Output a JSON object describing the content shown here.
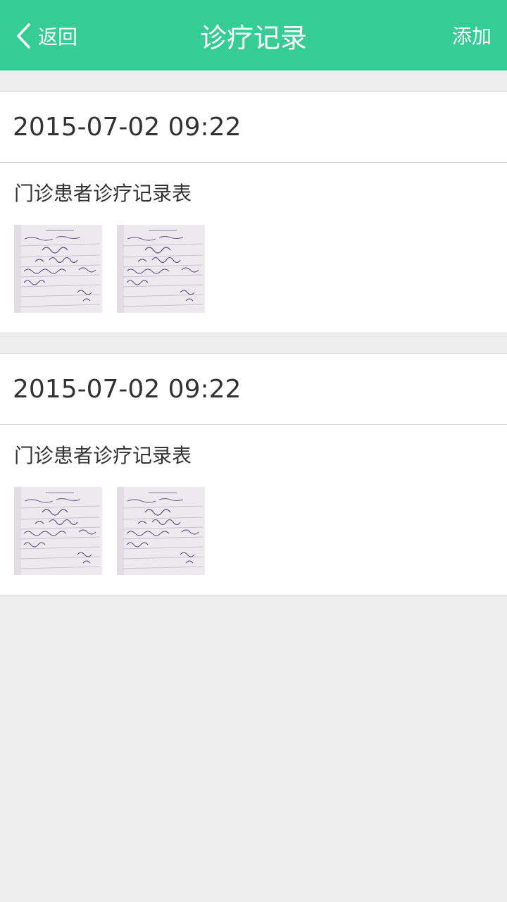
{
  "nav": {
    "back_label": "返回",
    "title": "诊疗记录",
    "add_label": "添加"
  },
  "records": [
    {
      "datetime": "2015-07-02 09:22",
      "name": "门诊患者诊疗记录表",
      "images": [
        "record-photo",
        "record-photo"
      ]
    },
    {
      "datetime": "2015-07-02 09:22",
      "name": "门诊患者诊疗记录表",
      "images": [
        "record-photo",
        "record-photo"
      ]
    }
  ],
  "colors": {
    "header": "#36cc95",
    "background": "#ededed",
    "card": "#ffffff",
    "text": "#333333"
  }
}
